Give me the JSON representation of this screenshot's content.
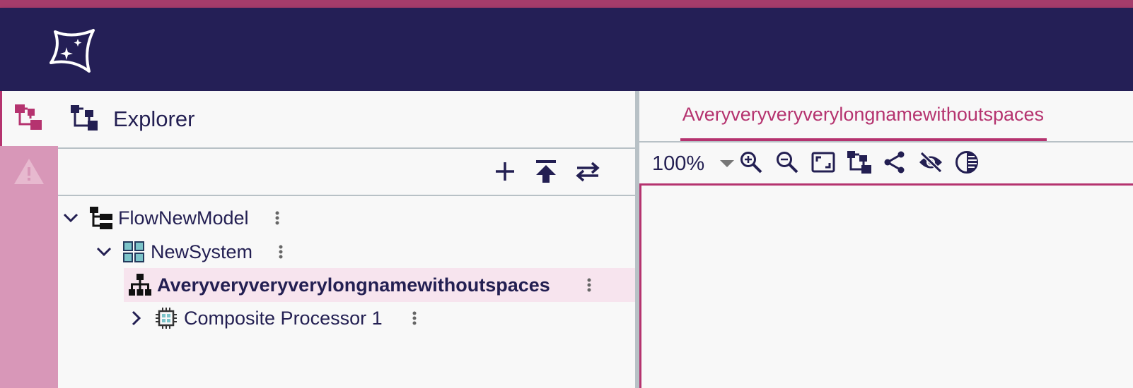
{
  "app": {
    "colors": {
      "appbar": "#241f56",
      "stripe": "#a53c6b",
      "accent": "#b5336f",
      "rail": "#d897b8",
      "selection": "#f7e4ee"
    }
  },
  "rail": {
    "items": [
      {
        "icon": "explorer-tree-icon",
        "active": true
      },
      {
        "icon": "warning-triangle-icon",
        "active": false
      }
    ]
  },
  "explorer": {
    "title": "Explorer",
    "toolbar": [
      {
        "icon": "add-icon"
      },
      {
        "icon": "collapse-to-top-icon"
      },
      {
        "icon": "swap-arrows-icon"
      }
    ],
    "tree": [
      {
        "label": "FlowNewModel",
        "icon": "model-tree-icon",
        "expanded": true,
        "selected": false
      },
      {
        "label": "NewSystem",
        "icon": "system-grid-icon",
        "expanded": true,
        "selected": false
      },
      {
        "label": "Averyveryveryverylongnamewithoutspaces",
        "icon": "hierarchy-icon",
        "selected": true
      },
      {
        "label": "Composite Processor 1",
        "icon": "chip-icon",
        "expanded": false,
        "selected": false
      }
    ]
  },
  "editor": {
    "tab_label": "Averyveryveryverylongnamewithoutspaces",
    "zoom": "100%",
    "toolbar": [
      {
        "icon": "zoom-in-icon"
      },
      {
        "icon": "zoom-out-icon"
      },
      {
        "icon": "fit-screen-icon"
      },
      {
        "icon": "tree-layout-icon"
      },
      {
        "icon": "share-icon"
      },
      {
        "icon": "visibility-off-icon"
      },
      {
        "icon": "contrast-icon"
      }
    ]
  }
}
